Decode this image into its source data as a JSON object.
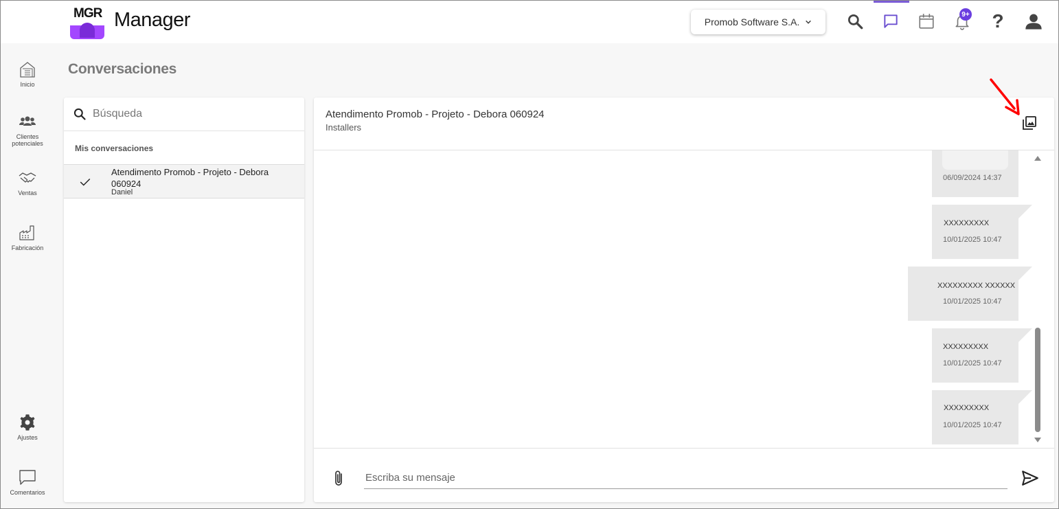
{
  "app": {
    "logo_text": "MGR",
    "title": "Manager"
  },
  "header": {
    "company": "Promob Software S.A.",
    "notification_badge": "9+",
    "help_label": "?"
  },
  "sidebar": {
    "items": [
      {
        "label": "Inicio",
        "icon": "home-icon"
      },
      {
        "label": "Clientes potenciales",
        "icon": "people-icon"
      },
      {
        "label": "Ventas",
        "icon": "handshake-icon"
      },
      {
        "label": "Fabricación",
        "icon": "factory-icon"
      },
      {
        "label": "Ajustes",
        "icon": "gear-icon"
      },
      {
        "label": "Comentarios",
        "icon": "comment-icon"
      }
    ]
  },
  "page": {
    "title": "Conversaciones"
  },
  "conversations": {
    "search_placeholder": "Búsqueda",
    "section_label": "Mis conversaciones",
    "items": [
      {
        "title": "Atendimento Promob - Projeto - Debora 060924",
        "subtitle": "Daniel"
      }
    ]
  },
  "chat": {
    "title": "Atendimento Promob - Projeto - Debora 060924",
    "subtitle": "Installers",
    "messages": [
      {
        "text": "",
        "time": "06/09/2024 14:37"
      },
      {
        "text": "XXXXXXXXX",
        "time": "10/01/2025 10:47"
      },
      {
        "text": "XXXXXXXXX XXXXXX",
        "time": "10/01/2025 10:47"
      },
      {
        "text": "XXXXXXXXX",
        "time": "10/01/2025 10:47"
      },
      {
        "text": "XXXXXXXXX",
        "time": "10/01/2025 10:47"
      }
    ],
    "composer_placeholder": "Escriba su mensaje"
  },
  "colors": {
    "accent": "#7b5cd6",
    "badge": "#6b3fe0",
    "logo_purple": "#a347ff",
    "annotation_arrow": "#ff0000",
    "bubble": "#e8e8e8"
  }
}
